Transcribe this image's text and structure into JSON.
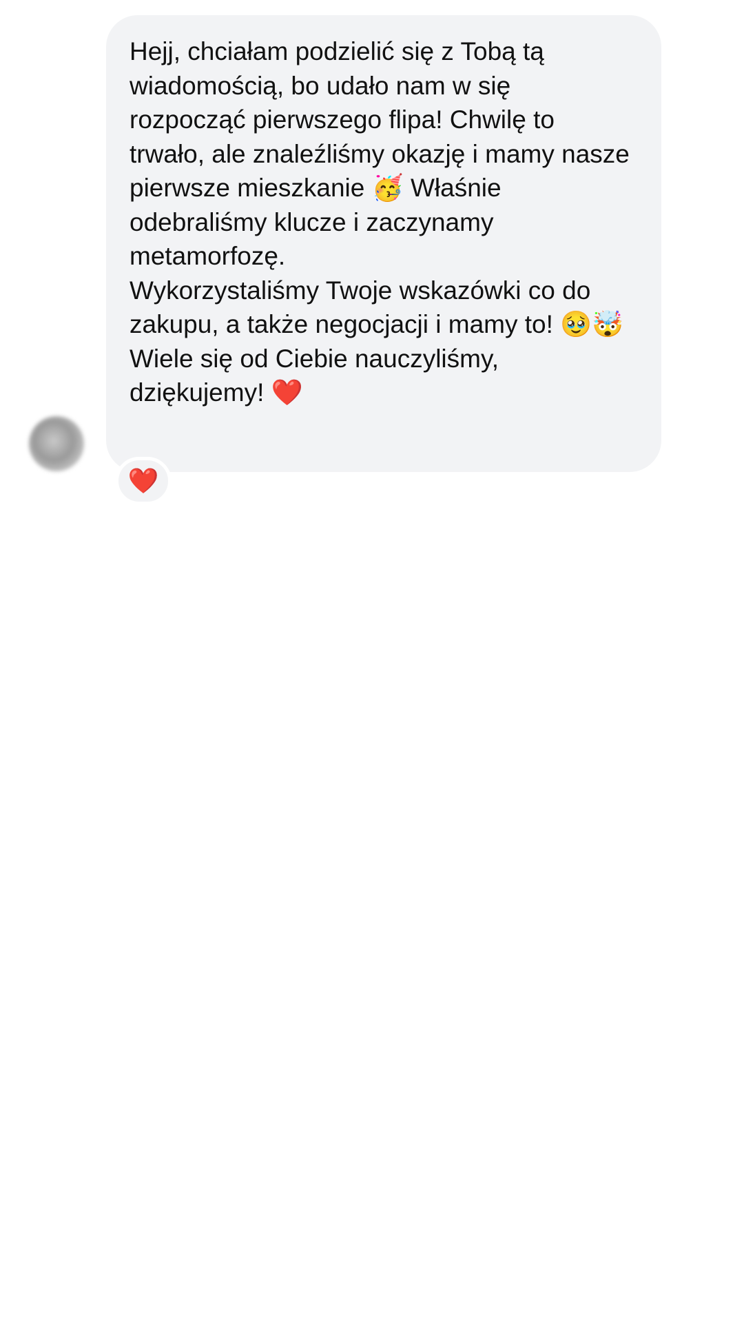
{
  "conversation": {
    "message": {
      "paragraphs": [
        "Hejj, chciałam podzielić się z Tobą tą wiadomością, bo udało nam w się rozpocząć pierwszego flipa! Chwilę to trwało, ale znaleźliśmy okazję i mamy nasze pierwsze mieszkanie 🥳 Właśnie odebraliśmy klucze i zaczynamy metamorfozę.",
        "Wykorzystaliśmy Twoje wskazówki co do zakupu, a także negocjacji i mamy to! 🥹🤯",
        "Wiele się od Ciebie nauczyliśmy, dziękujemy! ❤️"
      ]
    },
    "reaction": {
      "emoji": "❤️"
    },
    "avatar": {
      "icon": "blurred-avatar"
    }
  },
  "colors": {
    "bubble_background": "#f2f3f5",
    "text": "#111111",
    "page_background": "#ffffff",
    "heart": "#e0142a"
  }
}
